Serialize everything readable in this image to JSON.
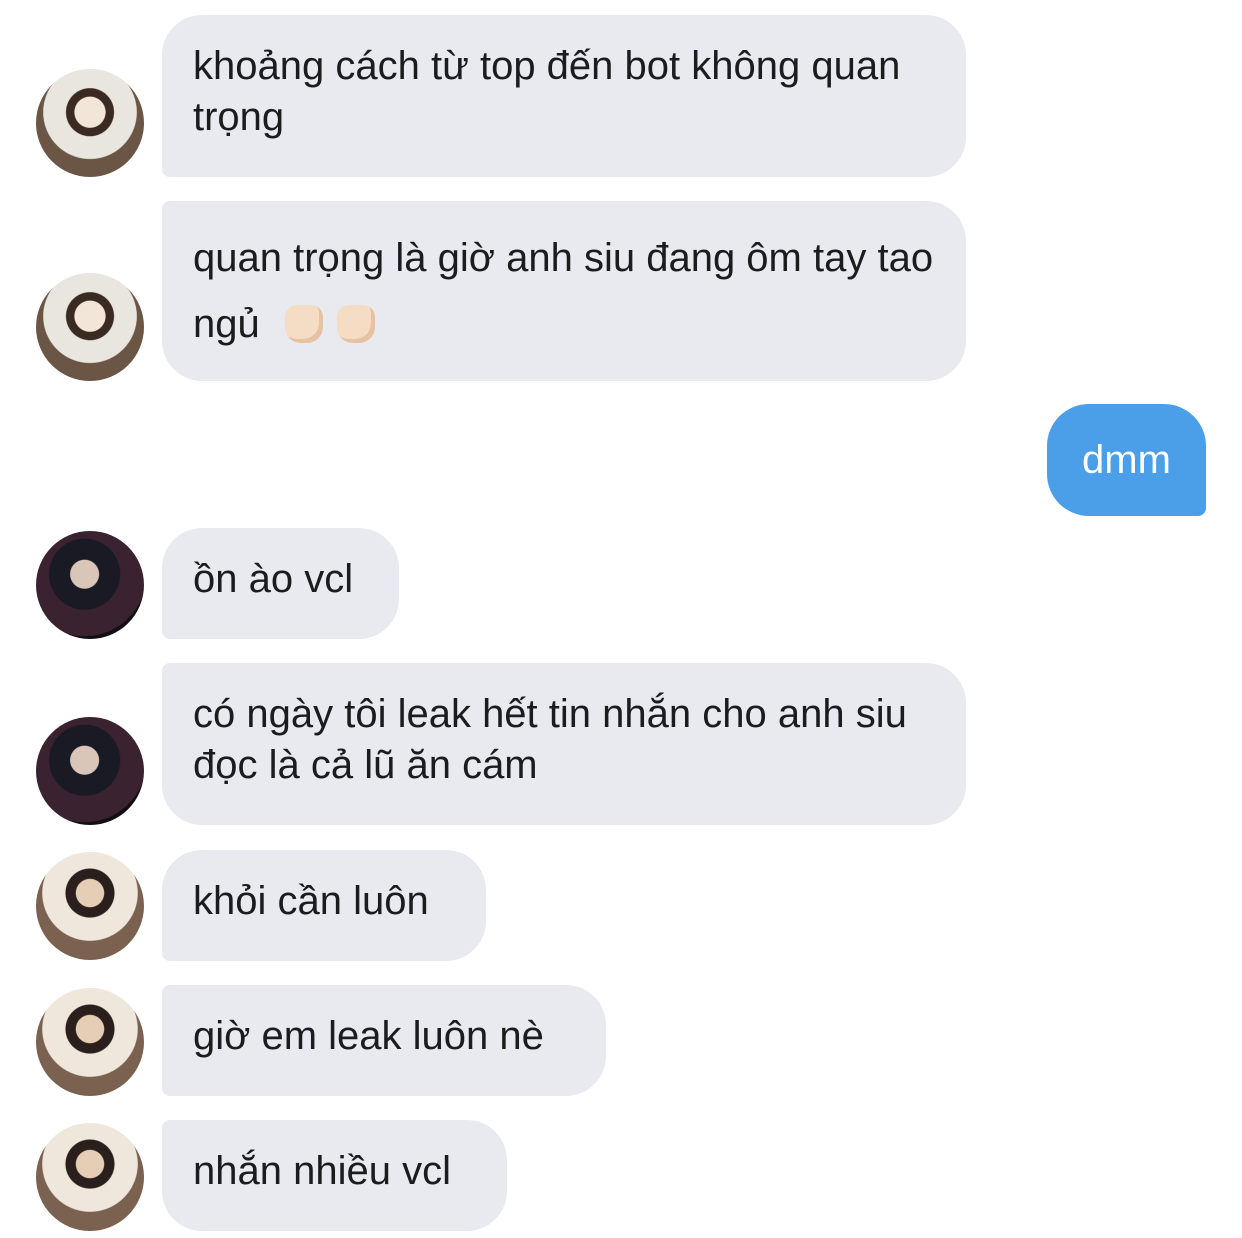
{
  "messages": [
    {
      "text": "khoảng cách từ top đến bot không quan trọng"
    },
    {
      "text": "quan trọng là giờ anh siu đang ôm tay tao ngủ"
    },
    {
      "text": "dmm"
    },
    {
      "text": "ồn ào vcl"
    },
    {
      "text": "có ngày tôi leak hết tin nhắn cho anh siu đọc là cả lũ ăn cám"
    },
    {
      "text": "khỏi cần luôn"
    },
    {
      "text": "giờ em leak luôn nè"
    },
    {
      "text": "nhắn nhiều vcl"
    }
  ],
  "emoji": {
    "name": "thumbs-up-light-skin",
    "count": 2
  }
}
